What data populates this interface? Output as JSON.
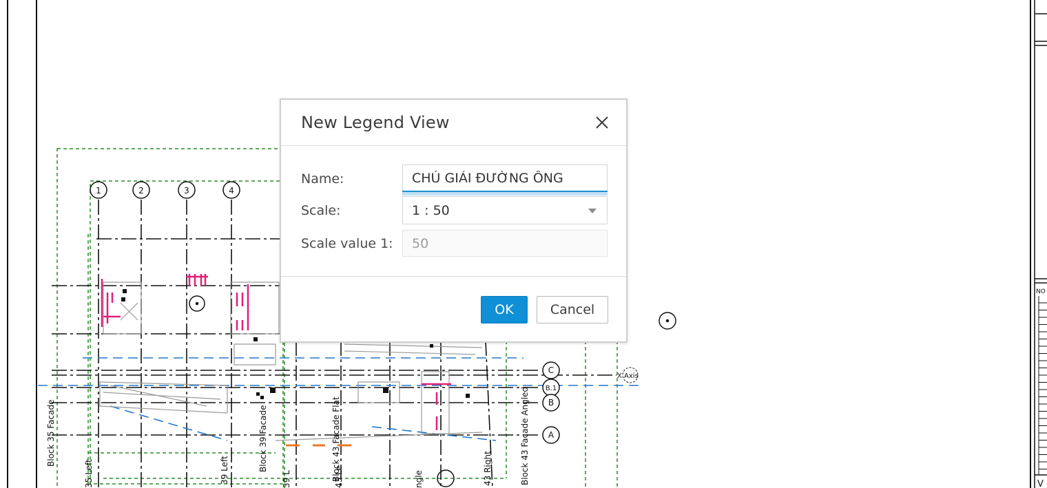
{
  "dialog": {
    "title": "New Legend View",
    "name_label": "Name:",
    "name_value": "CHÚ GIẢI ĐƯỜNG ỐNG",
    "scale_label": "Scale:",
    "scale_selected": "1 : 50",
    "scale_value_label": "Scale value  1:",
    "scale_value": "50",
    "ok_label": "OK",
    "cancel_label": "Cancel",
    "close_icon": "close-icon",
    "accent_color": "#0f8fd6"
  },
  "drawing": {
    "grid_top": [
      "1",
      "2",
      "3",
      "4"
    ],
    "grid_right": [
      "C",
      "B.1",
      "B",
      "A"
    ],
    "x_axis_label": "X Axis",
    "views": [
      "Block 35 Facade",
      "35 Left",
      "39 Left",
      "Block 39 Facade",
      "39 L",
      "Block 43 Facade Flat",
      "43 Le",
      "ngle",
      "43 Right",
      "Block 43 Facade Angled"
    ],
    "title_block_label": "NO",
    "title_block_partial": "V"
  }
}
